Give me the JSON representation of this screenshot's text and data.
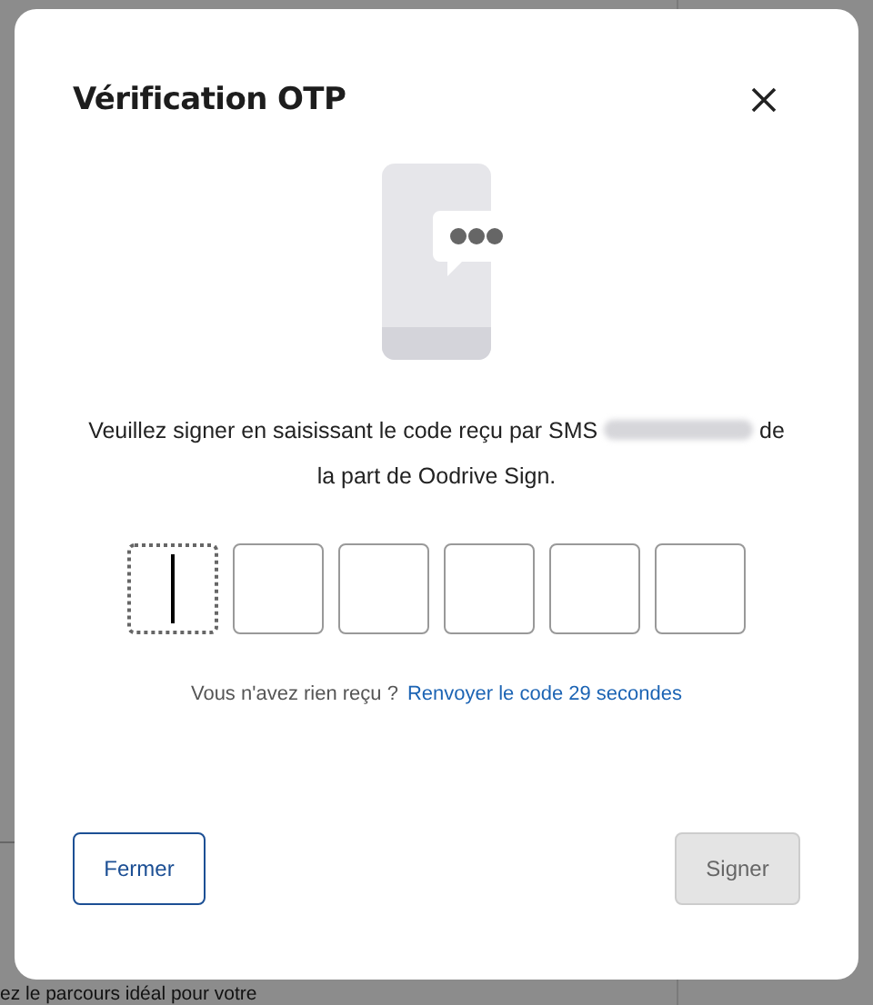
{
  "background_text": "ez le parcours idéal pour votre",
  "dialog": {
    "title": "Vérification OTP",
    "message": {
      "before": "Veuillez signer en saisissant le code reçu par SMS",
      "after": "de",
      "line2": "la part de Oodrive Sign."
    },
    "otp_digits": [
      {
        "focused": true
      },
      {
        "focused": false
      },
      {
        "focused": false
      },
      {
        "focused": false
      },
      {
        "focused": false
      },
      {
        "focused": false
      }
    ],
    "resend": {
      "prompt": "Vous n'avez rien reçu ?",
      "link": "Renvoyer le code 29 secondes"
    },
    "buttons": [
      {
        "label": "Fermer",
        "kind": "secondary",
        "disabled": false
      },
      {
        "label": "Signer",
        "kind": "primary",
        "disabled": true
      }
    ]
  }
}
